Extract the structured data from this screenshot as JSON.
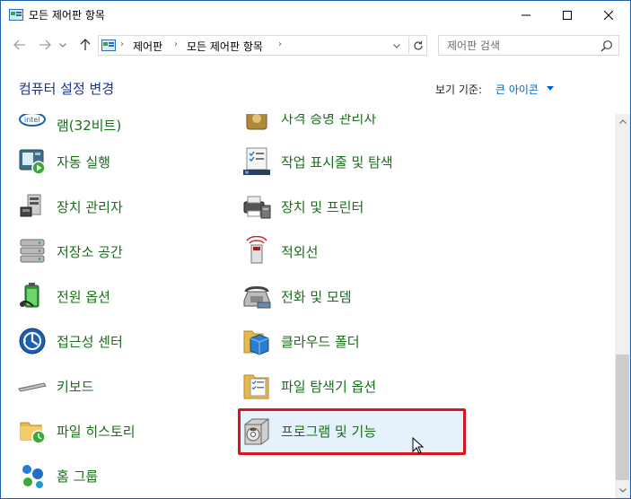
{
  "window": {
    "title": "모든 제어판 항목"
  },
  "address": {
    "crumbs": [
      "제어판",
      "모든 제어판 항목"
    ]
  },
  "search": {
    "placeholder": "제어판 검색"
  },
  "header": {
    "title": "컴퓨터 설정 변경",
    "view_by_label": "보기 기준:",
    "view_by_value": "큰 아이콘"
  },
  "items": {
    "left": [
      {
        "label": "램(32비트)",
        "icon": "intel-graphics-icon"
      },
      {
        "label": "자동 실행",
        "icon": "autoplay-icon"
      },
      {
        "label": "장치 관리자",
        "icon": "device-manager-icon"
      },
      {
        "label": "저장소 공간",
        "icon": "storage-spaces-icon"
      },
      {
        "label": "전원 옵션",
        "icon": "power-options-icon"
      },
      {
        "label": "접근성 센터",
        "icon": "ease-of-access-icon"
      },
      {
        "label": "키보드",
        "icon": "keyboard-icon"
      },
      {
        "label": "파일 히스토리",
        "icon": "file-history-icon"
      },
      {
        "label": "홈 그룹",
        "icon": "homegroup-icon"
      }
    ],
    "right": [
      {
        "label": "자격 증명 관리자",
        "icon": "credential-manager-icon"
      },
      {
        "label": "작업 표시줄 및 탐색",
        "icon": "taskbar-icon"
      },
      {
        "label": "장치 및 프린터",
        "icon": "devices-printers-icon"
      },
      {
        "label": "적외선",
        "icon": "infrared-icon"
      },
      {
        "label": "전화 및 모뎀",
        "icon": "phone-modem-icon"
      },
      {
        "label": "클라우드 폴더",
        "icon": "work-folders-icon"
      },
      {
        "label": "파일 탐색기 옵션",
        "icon": "explorer-options-icon"
      },
      {
        "label": "프로그램 및 기능",
        "icon": "programs-features-icon"
      }
    ]
  },
  "colors": {
    "link_green": "#1a6e1a",
    "title_blue": "#1e3287",
    "highlight_red": "#d9151f",
    "hover_blue": "#e5f1fb"
  }
}
